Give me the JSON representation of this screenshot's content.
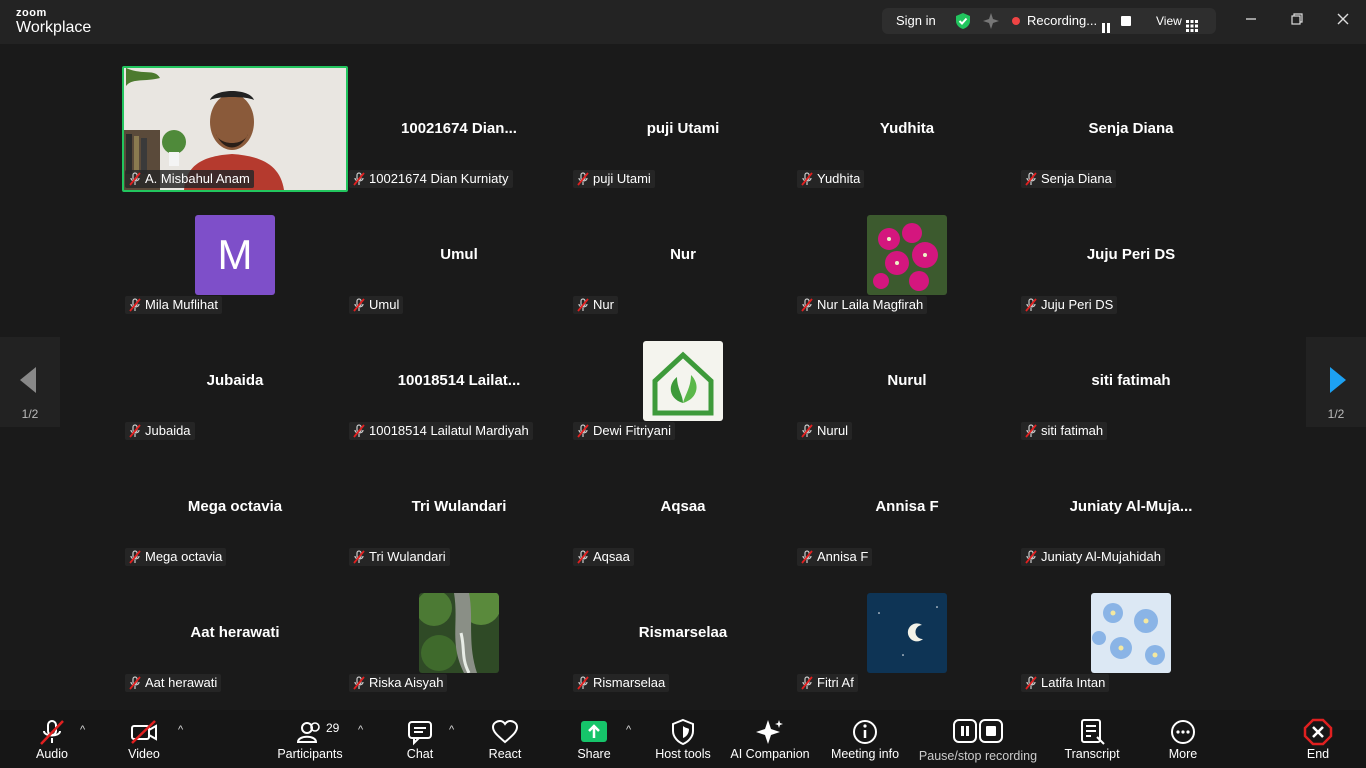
{
  "app": {
    "brand_small": "zoom",
    "brand_large": "Workplace"
  },
  "status_pill": {
    "sign_in": "Sign in",
    "recording": "Recording...",
    "view": "View"
  },
  "colors": {
    "accent_green": "#22c55e",
    "record_red": "#ef4444",
    "end_red": "#e02020",
    "share_green": "#16c46a",
    "next_arrow_blue": "#1da1f2"
  },
  "tiles": [
    {
      "name": "A. Misbahul Anam",
      "display": "",
      "type": "video"
    },
    {
      "name": "10021674 Dian Kurniaty",
      "display": "10021674 Dian...",
      "type": "name"
    },
    {
      "name": "puji Utami",
      "display": "puji Utami",
      "type": "name"
    },
    {
      "name": "Yudhita",
      "display": "Yudhita",
      "type": "name"
    },
    {
      "name": "Senja Diana",
      "display": "Senja Diana",
      "type": "name"
    },
    {
      "name": "Mila Muflihat",
      "display": "",
      "type": "avatar",
      "avatar_letter": "M",
      "avatar_color": "#7e4fc9"
    },
    {
      "name": "Umul",
      "display": "Umul",
      "type": "name"
    },
    {
      "name": "Nur",
      "display": "Nur",
      "type": "name"
    },
    {
      "name": "Nur Laila Magfirah",
      "display": "",
      "type": "avatar-flower"
    },
    {
      "name": "Juju Peri DS",
      "display": "Juju Peri DS",
      "type": "name"
    },
    {
      "name": "Jubaida",
      "display": "Jubaida",
      "type": "name"
    },
    {
      "name": "10018514 Lailatul Mardiyah",
      "display": "10018514 Lailat...",
      "type": "name"
    },
    {
      "name": "Dewi Fitriyani",
      "display": "",
      "type": "avatar-house"
    },
    {
      "name": "Nurul",
      "display": "Nurul",
      "type": "name"
    },
    {
      "name": "siti fatimah",
      "display": "siti fatimah",
      "type": "name"
    },
    {
      "name": "Mega octavia",
      "display": "Mega octavia",
      "type": "name"
    },
    {
      "name": "Tri Wulandari",
      "display": "Tri Wulandari",
      "type": "name"
    },
    {
      "name": "Aqsaa",
      "display": "Aqsaa",
      "type": "name"
    },
    {
      "name": "Annisa F",
      "display": "Annisa F",
      "type": "name"
    },
    {
      "name": "Juniaty Al-Mujahidah",
      "display": "Juniaty  Al-Muja...",
      "type": "name"
    },
    {
      "name": "Aat herawati",
      "display": "Aat herawati",
      "type": "name"
    },
    {
      "name": "Riska Aisyah",
      "display": "",
      "type": "avatar-forest"
    },
    {
      "name": "Rismarselaa",
      "display": "Rismarselaa",
      "type": "name"
    },
    {
      "name": "Fitri Af",
      "display": "",
      "type": "avatar-moon"
    },
    {
      "name": "Latifa Intan",
      "display": "",
      "type": "avatar-blueflower"
    }
  ],
  "pager": {
    "left": "1/2",
    "right": "1/2"
  },
  "toolbar": {
    "audio": "Audio",
    "video": "Video",
    "participants": "Participants",
    "participants_count": "29",
    "chat": "Chat",
    "react": "React",
    "share": "Share",
    "host_tools": "Host tools",
    "ai_companion": "AI Companion",
    "meeting_info": "Meeting info",
    "pause_stop_recording": "Pause/stop recording",
    "transcript": "Transcript",
    "more": "More",
    "end": "End"
  }
}
